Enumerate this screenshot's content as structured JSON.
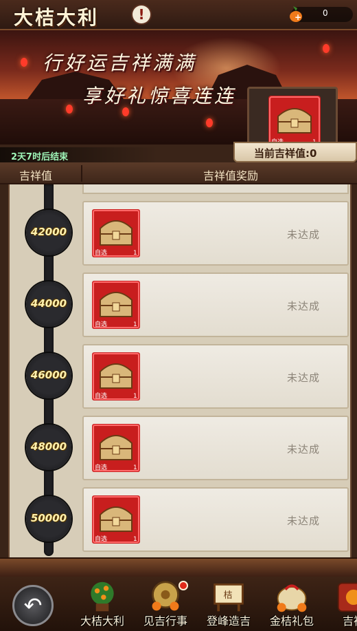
{
  "header": {
    "title": "大桔大利",
    "currency_value": "0"
  },
  "banner": {
    "slogan_line1": "行好运吉祥满满",
    "slogan_line2": "享好礼惊喜连连",
    "countdown": "2天7时后结束",
    "current_reward": {
      "item_tag": "自选",
      "count": "1",
      "label": "当前吉祥值:0"
    }
  },
  "table": {
    "header_left": "吉祥值",
    "header_right": "吉祥值奖励",
    "rows": [
      {
        "threshold": "42000",
        "item_tag": "自选",
        "count": "1",
        "status": "未达成"
      },
      {
        "threshold": "44000",
        "item_tag": "自选",
        "count": "1",
        "status": "未达成"
      },
      {
        "threshold": "46000",
        "item_tag": "自选",
        "count": "1",
        "status": "未达成"
      },
      {
        "threshold": "48000",
        "item_tag": "自选",
        "count": "1",
        "status": "未达成"
      },
      {
        "threshold": "50000",
        "item_tag": "自选",
        "count": "1",
        "status": "未达成"
      }
    ]
  },
  "bottom_nav": {
    "back_icon": "back-arrow-icon",
    "tabs": [
      {
        "label": "大桔大利",
        "icon": "orange-tree-icon"
      },
      {
        "label": "见吉行事",
        "icon": "gong-icon",
        "badge": true
      },
      {
        "label": "登峰造吉",
        "icon": "plaque-icon"
      },
      {
        "label": "金桔礼包",
        "icon": "gift-bag-icon"
      },
      {
        "label": "吉祥",
        "icon": "lucky-icon"
      }
    ]
  },
  "colors": {
    "accent": "#d23a2a",
    "status_text": "#8c8478",
    "threshold_text": "#fff2b0"
  }
}
